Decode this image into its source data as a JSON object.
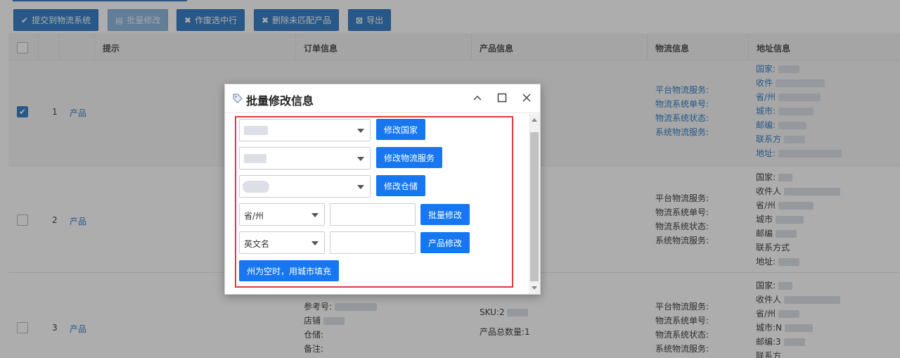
{
  "toolbar": {
    "buttons": [
      {
        "label": "提交到物流系统",
        "icon": "check-icon"
      },
      {
        "label": "批量修改",
        "icon": "edit-icon"
      },
      {
        "label": "作废选中行",
        "icon": "x-icon"
      },
      {
        "label": "删除未匹配产品",
        "icon": "x-icon"
      },
      {
        "label": "导出",
        "icon": "export-icon"
      }
    ]
  },
  "table": {
    "headers": [
      "提示",
      "订单信息",
      "产品信息",
      "物流信息",
      "地址信息"
    ],
    "rows": [
      {
        "num": "1",
        "product_link": "产品",
        "logistics": [
          "平台物流服务:",
          "物流系统单号:",
          "物流系统状态:",
          "系统物流服务:"
        ],
        "address": [
          "国家:",
          "收件",
          "省/州",
          "城市:",
          "邮编:",
          "联系方",
          "地址:"
        ]
      },
      {
        "num": "2",
        "product_link": "产品",
        "logistics": [
          "平台物流服务:",
          "物流系统单号:",
          "物流系统状态:",
          "系统物流服务:"
        ],
        "address": [
          "国家:",
          "收件人",
          "省/州",
          "城市",
          "邮编",
          "联系方式",
          "地址:"
        ]
      },
      {
        "num": "3",
        "product_link": "产品",
        "order": [
          "参考号:",
          "店铺",
          "仓储:",
          "备注:"
        ],
        "product": [
          "SKU:2",
          "产品总数量:1"
        ],
        "logistics": [
          "平台物流服务:",
          "物流系统单号:",
          "物流系统状态:",
          "系统物流服务:"
        ],
        "address": [
          "国家:",
          "收件人",
          "省/州",
          "城市:N",
          "邮编:3",
          "联系方"
        ]
      }
    ]
  },
  "dialog": {
    "title": "批量修改信息",
    "buttons": {
      "country": "修改国家",
      "logistics": "修改物流服务",
      "warehouse": "修改仓储",
      "batch": "批量修改",
      "product": "产品修改",
      "fill_city": "州为空时，用城市填充"
    },
    "selects": {
      "field": "省/州",
      "product_field": "英文名"
    }
  }
}
